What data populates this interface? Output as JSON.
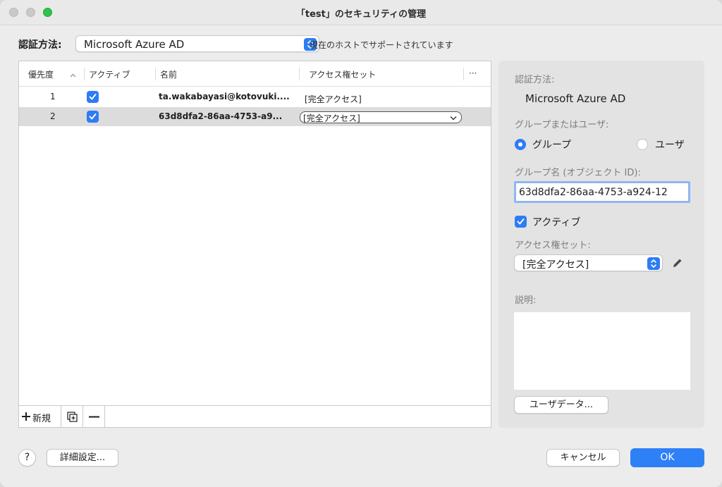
{
  "window": {
    "title": "「test」のセキュリティの管理"
  },
  "auth": {
    "label": "認証方法:",
    "selected": "Microsoft Azure AD",
    "note": "現在のホストでサポートされています"
  },
  "table": {
    "columns": [
      "優先度",
      "アクティブ",
      "名前",
      "アクセス権セット",
      "···"
    ],
    "sort_indicator": "^",
    "rows": [
      {
        "priority": "1",
        "active": true,
        "name": "ta.wakabayasi@kotovuki....",
        "access": "[完全アクセス]",
        "selected": false
      },
      {
        "priority": "2",
        "active": true,
        "name": "63d8dfa2-86aa-4753-a9...",
        "access": "[完全アクセス]",
        "selected": true
      }
    ],
    "footer": {
      "new_label": "新規"
    }
  },
  "detail": {
    "auth_label": "認証方法:",
    "auth_value": "Microsoft Azure AD",
    "group_or_user_label": "グループまたはユーザ:",
    "radio_group_label": "グループ",
    "radio_user_label": "ユーザ",
    "radio_selected": "group",
    "group_name_label": "グループ名 (オブジェクト ID):",
    "group_name_value": "63d8dfa2-86aa-4753-a924-12",
    "active_label": "アクティブ",
    "active_checked": true,
    "access_set_label": "アクセス権セット:",
    "access_set_value": "[完全アクセス]",
    "description_label": "説明:",
    "description_value": "",
    "user_data_button": "ユーザデータ..."
  },
  "buttons": {
    "help": "?",
    "advanced": "詳細設定...",
    "cancel": "キャンセル",
    "ok": "OK"
  },
  "colors": {
    "accent": "#2d7cf6",
    "selection_row": "#dcdcdc",
    "panel_bg": "#e3e3e3"
  },
  "icons": {
    "stepper": "up-down-chevron-icon",
    "sort": "chevron-up-icon",
    "check": "checkmark-icon",
    "add": "plus-icon",
    "duplicate": "duplicate-icon",
    "remove": "minus-icon",
    "edit": "pencil-icon"
  }
}
